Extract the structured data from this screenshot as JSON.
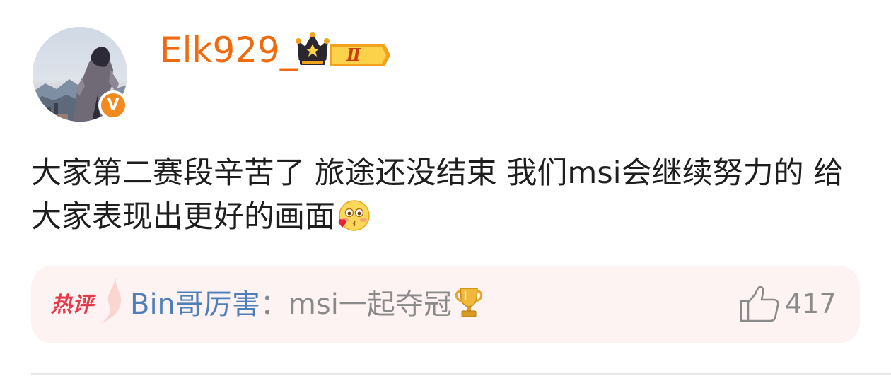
{
  "post": {
    "username": "Elk929_",
    "vip_level": "Ⅱ",
    "verified_mark": "V",
    "text": "大家第二赛段辛苦了 旅途还没结束 我们msi会继续努力的 给大家表现出更好的画面"
  },
  "hot_comment": {
    "label": "热评",
    "author": "Bin哥厉害",
    "colon": "：",
    "text": "msi一起夺冠",
    "likes": "417"
  },
  "colors": {
    "username": "#f06b10",
    "comment_author": "#4e7fb8",
    "hot_label": "#e8394a",
    "verified": "#f38a1d"
  },
  "icons": {
    "verified": "verified-v-icon",
    "vip": "crown-vip-badge-icon",
    "emoji": "blushing-kiss-emoji-icon",
    "trophy": "trophy-icon",
    "like": "thumbs-up-icon"
  }
}
